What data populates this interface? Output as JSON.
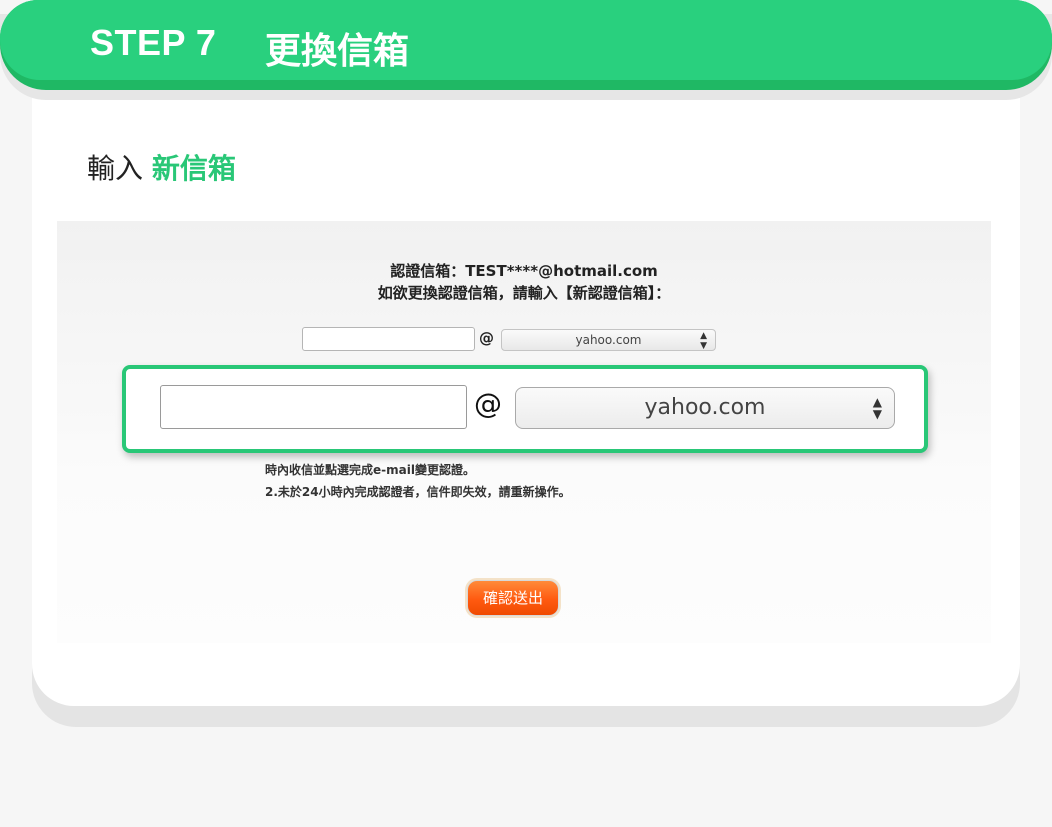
{
  "header": {
    "step": "STEP 7",
    "title": "更換信箱"
  },
  "section": {
    "title_prefix": "輸入",
    "title_accent": "新信箱"
  },
  "panel": {
    "current_email_line": "認證信箱：TEST****@hotmail.com",
    "instruction_line": "如欲更換認證信箱，請輸入【新認證信箱】：",
    "at_symbol": "@",
    "domain_selected": "yahoo.com",
    "note_line_1": "時內收信並點選完成e-mail變更認證。",
    "note_line_2": "2.未於24小時內完成認證者，信件即失效，請重新操作。",
    "submit_label": "確認送出"
  },
  "zoom": {
    "at_symbol": "@",
    "domain_selected": "yahoo.com"
  },
  "colors": {
    "brand_green": "#29d07e",
    "accent_green": "#29c777",
    "button_orange": "#ff5a10"
  }
}
